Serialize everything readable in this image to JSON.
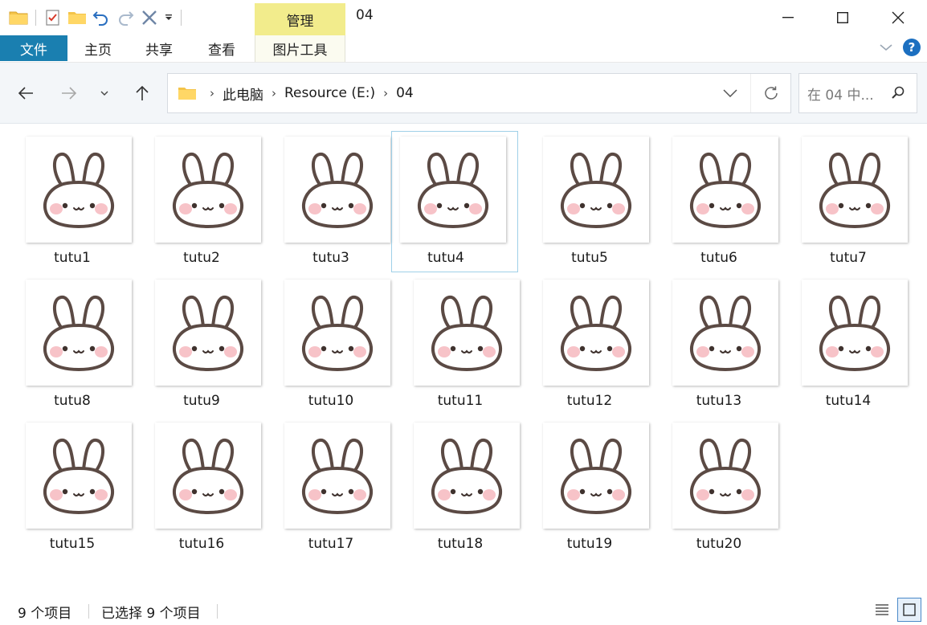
{
  "window": {
    "title": "04",
    "contextual_tab": "管理"
  },
  "ribbon": {
    "tabs": [
      "文件",
      "主页",
      "共享",
      "查看",
      "图片工具"
    ]
  },
  "address": {
    "crumbs": [
      "此电脑",
      "Resource (E:)",
      "04"
    ]
  },
  "search": {
    "placeholder": "在 04 中..."
  },
  "files": [
    {
      "name": "tutu1"
    },
    {
      "name": "tutu2"
    },
    {
      "name": "tutu3"
    },
    {
      "name": "tutu4",
      "selected": true
    },
    {
      "name": "tutu5"
    },
    {
      "name": "tutu6"
    },
    {
      "name": "tutu7"
    },
    {
      "name": "tutu8"
    },
    {
      "name": "tutu9"
    },
    {
      "name": "tutu10"
    },
    {
      "name": "tutu11"
    },
    {
      "name": "tutu12"
    },
    {
      "name": "tutu13"
    },
    {
      "name": "tutu14"
    },
    {
      "name": "tutu15"
    },
    {
      "name": "tutu16"
    },
    {
      "name": "tutu17"
    },
    {
      "name": "tutu18"
    },
    {
      "name": "tutu19"
    },
    {
      "name": "tutu20"
    }
  ],
  "status": {
    "item_count": "9 个项目",
    "selected_count": "已选择 9 个项目"
  },
  "colors": {
    "file_tab": "#1a7fb0",
    "manage_tab": "#f2ec8c",
    "bunny_outline": "#5b4a44",
    "bunny_blush": "#f7c3c8"
  }
}
